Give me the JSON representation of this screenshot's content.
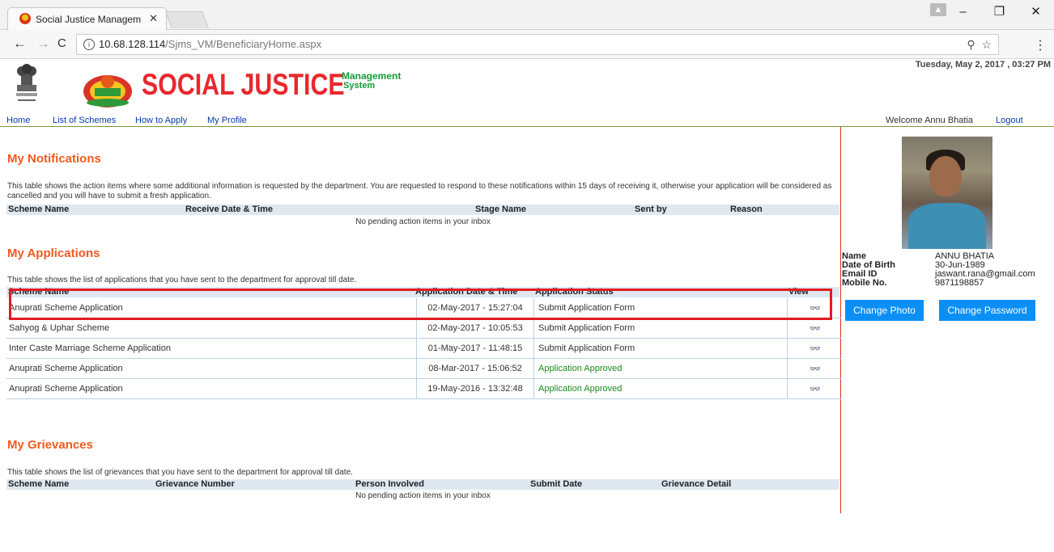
{
  "browser": {
    "tab_title": "Social Justice Manageme",
    "tab_close": "✕",
    "url_host": "10.68.128.114",
    "url_path": "/Sjms_VM/BeneficiaryHome.aspx",
    "nav_back": "←",
    "nav_forward": "→",
    "nav_reload": "C",
    "zoom_icon": "⚲",
    "star_icon": "☆",
    "menu": "⋮",
    "win_min": "–",
    "win_max": "❐",
    "win_close": "✕"
  },
  "header": {
    "brand_main": "SOCIAL JUSTICE",
    "brand_sub1": "Management",
    "brand_sub2": "System",
    "datetime": "Tuesday, May 2, 2017 , 03:27 PM"
  },
  "nav": {
    "items": [
      "Home",
      "List of Schemes",
      "How to Apply",
      "My Profile"
    ],
    "welcome": "Welcome Annu Bhatia",
    "logout": "Logout"
  },
  "notifications": {
    "title": "My Notifications",
    "description": "This table shows the action items where some additional information is requested by the department. You are requested to respond to these notifications within 15 days of receiving it, otherwise your application will be considered as cancelled and you will have to submit a fresh application.",
    "columns": [
      "Scheme Name",
      "Receive Date & Time",
      "Stage Name",
      "Sent by",
      "Reason"
    ],
    "empty": "No pending action items in your inbox"
  },
  "applications": {
    "title": "My Applications",
    "description": "This table shows the list of applications that you have sent to the department for approval till date.",
    "columns": [
      "Scheme Name",
      "Application Date & Time",
      "Application Status",
      "View"
    ],
    "rows": [
      {
        "name": "Anuprati Scheme Application",
        "date": "02-May-2017 - 15:27:04",
        "status": "Submit Application Form"
      },
      {
        "name": "Sahyog & Uphar Scheme",
        "date": "02-May-2017 - 10:05:53",
        "status": "Submit Application Form"
      },
      {
        "name": "Inter Caste Marriage Scheme Application",
        "date": "01-May-2017 - 11:48:15",
        "status": "Submit Application Form"
      },
      {
        "name": "Anuprati Scheme Application",
        "date": "08-Mar-2017 - 15:06:52",
        "status": "Application Approved"
      },
      {
        "name": "Anuprati Scheme Application",
        "date": "19-May-2016 - 13:32:48",
        "status": "Application Approved"
      }
    ],
    "view_icon": "view-glasses-icon"
  },
  "grievances": {
    "title": "My Grievances",
    "description": "This table shows the list of grievances that you have sent to the department for approval till date.",
    "columns": [
      "Scheme Name",
      "Grievance Number",
      "Person Involved",
      "Submit Date",
      "Grievance Detail"
    ],
    "empty": "No pending action items in your inbox"
  },
  "profile": {
    "labels": [
      "Name",
      "Date of Birth",
      "Email ID",
      "Mobile No."
    ],
    "name": "ANNU BHATIA",
    "dob": "30-Jun-1989",
    "email": "jaswant.rana@gmail.com",
    "mobile": "9871198857",
    "change_photo": "Change Photo",
    "change_password": "Change Password"
  },
  "colors": {
    "section_title": "#f05a1e",
    "brand": "#e8282d",
    "approved": "#1b8a1b",
    "button": "#0b8ff5",
    "highlight": "#e31b23"
  }
}
